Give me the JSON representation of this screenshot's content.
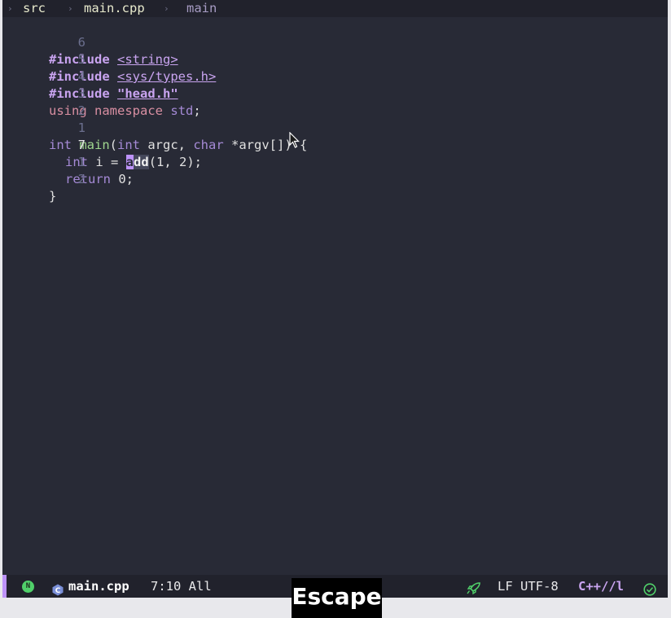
{
  "breadcrumb": {
    "folder": "src",
    "file": "main.cpp",
    "symbol": "main"
  },
  "editor": {
    "lines": [
      {
        "number": "6"
      },
      {
        "number": "5"
      },
      {
        "number": "4"
      },
      {
        "number": "3"
      },
      {
        "number": "2"
      },
      {
        "number": "1"
      },
      {
        "number": "7"
      },
      {
        "number": "1"
      },
      {
        "number": "2"
      }
    ],
    "tokens": {
      "include": "#include",
      "header_string": "<string>",
      "header_types": "<sys/types.h>",
      "header_local": "\"head.h\"",
      "using": "using",
      "namespace": "namespace",
      "std": "std",
      "semicolon": ";",
      "int": "int",
      "main": "main",
      "paren_open": "(",
      "argc": " argc, ",
      "char": "char",
      "argv": " *argv[]) {",
      "var_i": " i = ",
      "call_a": "a",
      "call_dd": "dd",
      "call_args": "(1, 2);",
      "return": "return",
      "return_val": " 0;",
      "brace_close": "}"
    }
  },
  "modeline": {
    "mode_badge": "N",
    "file": "main.cpp",
    "position": "7:10 All",
    "encoding": "LF UTF-8",
    "language": "C++//l"
  },
  "key_overlay": "Escape",
  "colors": {
    "background": "#282a36",
    "accent_purple": "#bd93f9",
    "badge_green": "#50d06a",
    "string_purple": "#c9a4f0"
  },
  "icons": [
    "cpp-icon",
    "rocket-icon",
    "check-circle-icon",
    "chevron-right-icon",
    "mouse-pointer-icon"
  ]
}
